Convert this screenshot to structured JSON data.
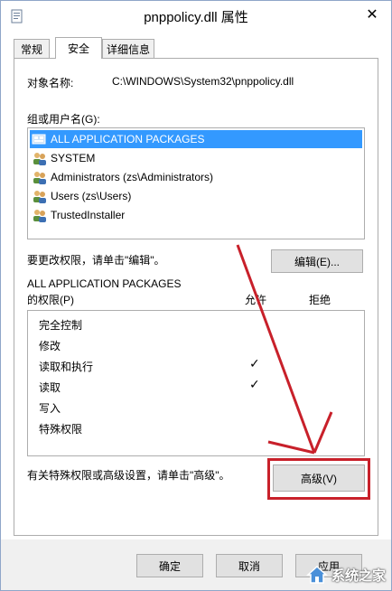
{
  "window": {
    "title": "pnppolicy.dll 属性",
    "close_glyph": "✕"
  },
  "tabs": [
    {
      "label": "常规",
      "active": false
    },
    {
      "label": "安全",
      "active": true
    },
    {
      "label": "详细信息",
      "active": false
    }
  ],
  "object": {
    "label": "对象名称:",
    "value": "C:\\WINDOWS\\System32\\pnppolicy.dll"
  },
  "groups": {
    "label": "组或用户名(G):",
    "items": [
      {
        "name": "ALL APPLICATION PACKAGES",
        "selected": true,
        "icon": "group-icon"
      },
      {
        "name": "SYSTEM",
        "selected": false,
        "icon": "users-icon"
      },
      {
        "name": "Administrators (zs\\Administrators)",
        "selected": false,
        "icon": "users-icon"
      },
      {
        "name": "Users (zs\\Users)",
        "selected": false,
        "icon": "users-icon"
      },
      {
        "name": "TrustedInstaller",
        "selected": false,
        "icon": "users-icon"
      }
    ]
  },
  "edit": {
    "hint": "要更改权限，请单击\"编辑\"。",
    "button": "编辑(E)..."
  },
  "permissions": {
    "principal": "ALL APPLICATION PACKAGES",
    "label": "的权限(P)",
    "allow_header": "允许",
    "deny_header": "拒绝",
    "rows": [
      {
        "name": "完全控制",
        "allow": false,
        "deny": false
      },
      {
        "name": "修改",
        "allow": false,
        "deny": false
      },
      {
        "name": "读取和执行",
        "allow": true,
        "deny": false
      },
      {
        "name": "读取",
        "allow": true,
        "deny": false
      },
      {
        "name": "写入",
        "allow": false,
        "deny": false
      },
      {
        "name": "特殊权限",
        "allow": false,
        "deny": false
      }
    ],
    "check_glyph": "✓"
  },
  "advanced": {
    "hint": "有关特殊权限或高级设置，请单击\"高级\"。",
    "button": "高级(V)"
  },
  "footer": {
    "ok": "确定",
    "cancel": "取消",
    "apply": "应用"
  },
  "annotation_color": "#c8202a",
  "watermark": {
    "text": "系统之家"
  }
}
